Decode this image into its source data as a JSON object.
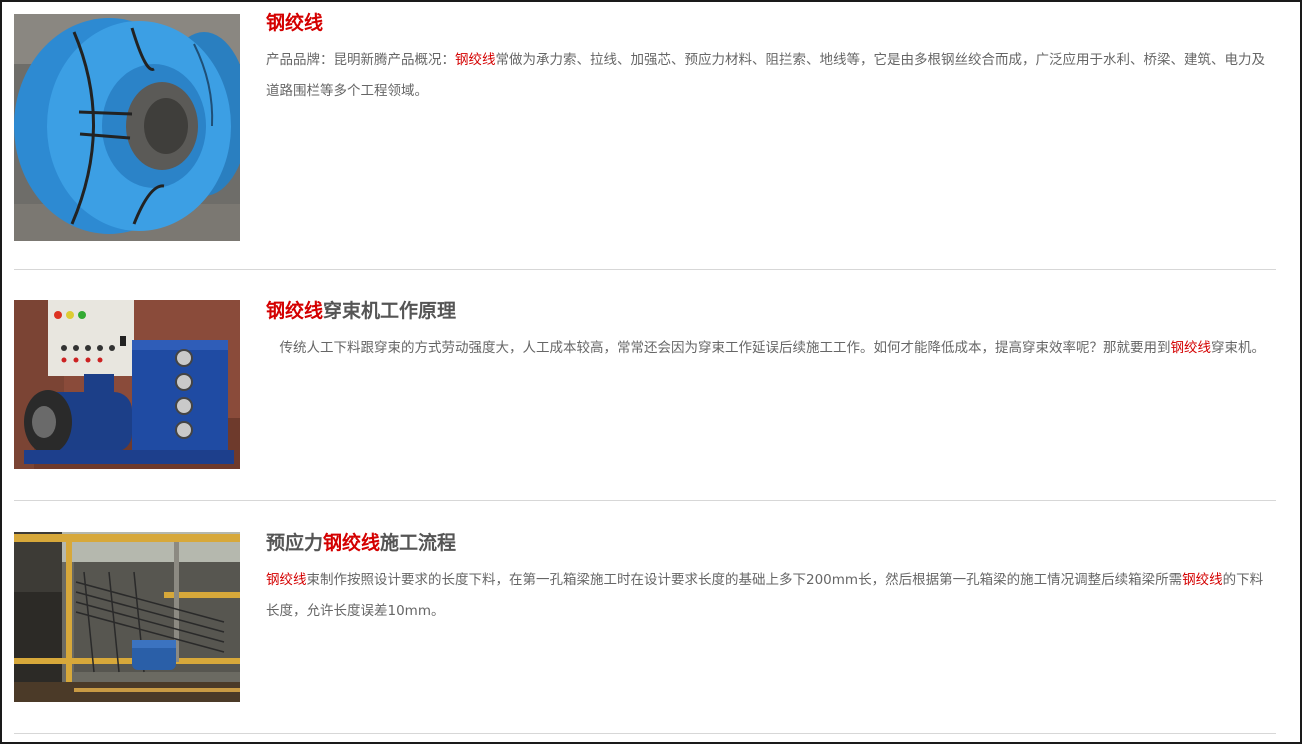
{
  "articles": [
    {
      "title_hl": "钢绞线",
      "title_rest": "",
      "desc_prefix": "产品品牌：昆明新腾产品概况：",
      "desc_hl": "钢绞线",
      "desc_rest": "常做为承力索、拉线、加强芯、预应力材料、阻拦索、地线等，它是由多根钢丝绞合而成，广泛应用于水利、桥梁、建筑、电力及道路围栏等多个工程领域。",
      "image": "blue-wrapped-steel-strand-coil"
    },
    {
      "title_hl": "钢绞线",
      "title_rest": "穿束机工作原理",
      "desc_prefix": "　传统人工下料跟穿束的方式劳动强度大，人工成本较高，常常还会因为穿束工作延误后续施工工作。如何才能降低成本，提高穿束效率呢？那就要用到",
      "desc_hl": "钢绞线",
      "desc_rest": "穿束机。",
      "image": "strand-threading-machine"
    },
    {
      "title_prefix": "预应力",
      "title_hl": "钢绞线",
      "title_rest": "施工流程",
      "desc_hl": "钢绞线",
      "desc_rest": "束制作按照设计要求的长度下料，在第一孔箱梁施工时在设计要求长度的基础上多下200mm长，然后根据第一孔箱梁的施工情况调整后续箱梁所需",
      "desc_hl2": "钢绞线",
      "desc_rest2": "的下料长度，允许长度误差10mm。",
      "image": "construction-site-prestressing"
    }
  ],
  "colors": {
    "highlight": "#d40000",
    "text": "#666666",
    "divider": "#d7d7d7"
  }
}
